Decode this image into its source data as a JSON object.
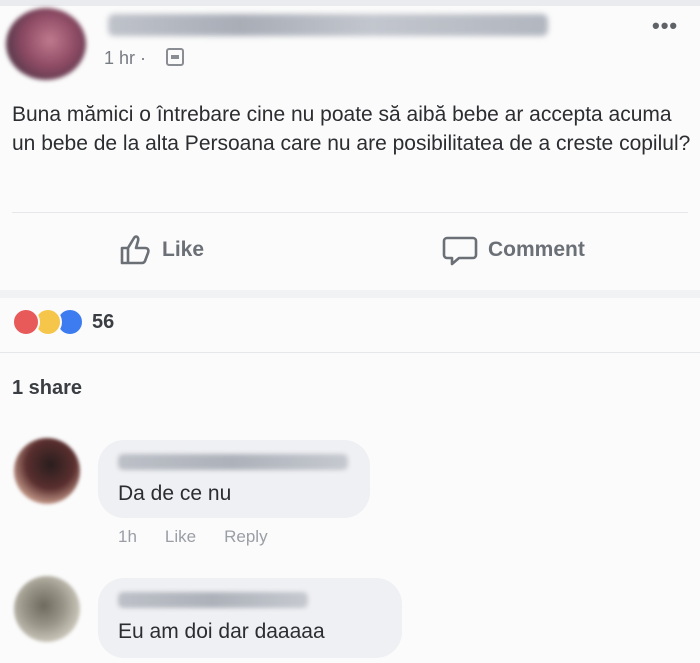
{
  "post": {
    "time": "1 hr ·",
    "text": "Buna mămici o întrebare cine nu poate să aibă bebe ar accepta acuma un bebe de la alta Persoana care nu are posibilitatea de a creste copilul?",
    "more_label": "•••"
  },
  "actions": {
    "like_label": "Like",
    "comment_label": "Comment"
  },
  "stats": {
    "reaction_count": "56",
    "share_label": "1 share"
  },
  "comments": [
    {
      "text": "Da de ce nu",
      "time": "1h",
      "like_label": "Like",
      "reply_label": "Reply"
    },
    {
      "text": "Eu am doi dar daaaaa"
    }
  ],
  "colors": {
    "background": "#fbfbfb",
    "bubble": "#eff0f3",
    "muted_text": "#6b6f76",
    "reaction_love": "#e85a5a",
    "reaction_haha": "#f6c64b",
    "reaction_like": "#3d7cf0"
  },
  "icons": [
    "globe-icon",
    "like-icon",
    "comment-icon",
    "more-icon"
  ]
}
